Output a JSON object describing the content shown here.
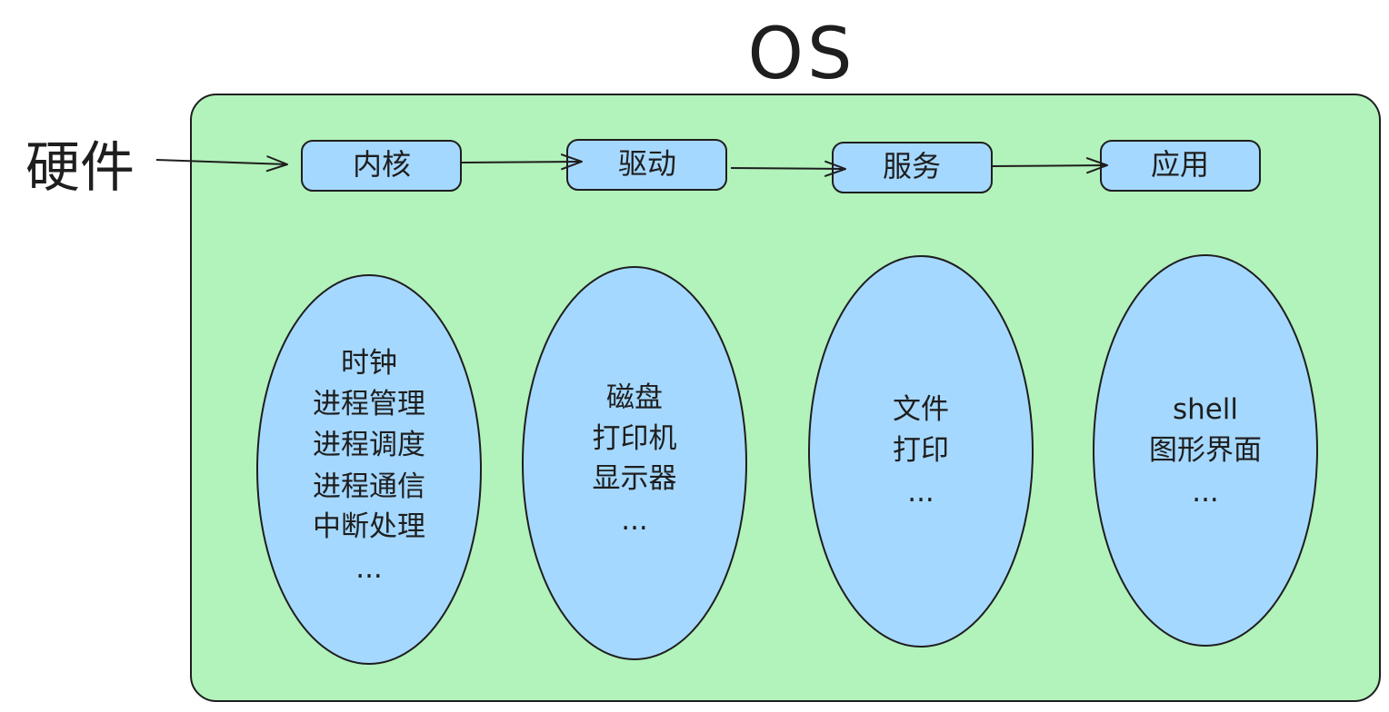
{
  "title": "OS",
  "hardware_label": "硬件",
  "stages": [
    {
      "label": "内核",
      "items": [
        "时钟",
        "进程管理",
        "进程调度",
        "进程通信",
        "中断处理",
        "..."
      ]
    },
    {
      "label": "驱动",
      "items": [
        "磁盘",
        "打印机",
        "显示器",
        "..."
      ]
    },
    {
      "label": "服务",
      "items": [
        "文件",
        "打印",
        "..."
      ]
    },
    {
      "label": "应用",
      "items": [
        "shell",
        "图形界面",
        "..."
      ]
    }
  ],
  "colors": {
    "container_fill": "#b2f2bb",
    "node_fill": "#a5d8ff",
    "stroke": "#1e1e1e"
  }
}
